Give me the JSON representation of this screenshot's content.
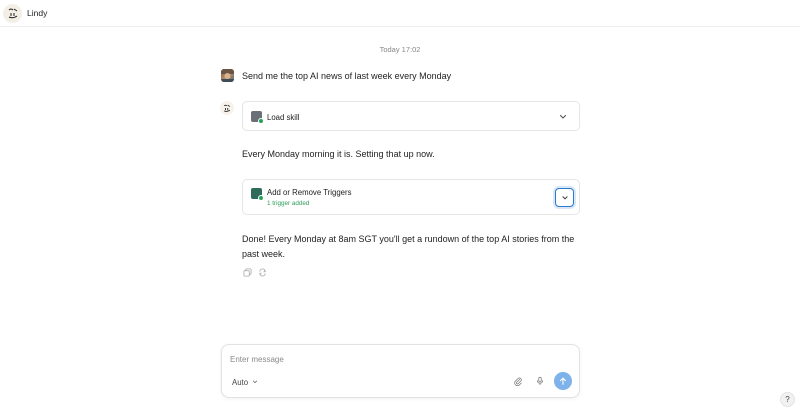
{
  "app": {
    "title": "Lindy"
  },
  "chat": {
    "timestamp": "Today 17:02",
    "user_message": "Send me the top AI news of last week every Monday",
    "tool_load_skill": {
      "title": "Load skill"
    },
    "agent_message_1": "Every Monday morning it is. Setting that up now.",
    "tool_triggers": {
      "title": "Add or Remove Triggers",
      "status": "1 trigger added"
    },
    "agent_message_2": "Done! Every Monday at 8am SGT you'll get a rundown of the top AI stories from the past week."
  },
  "composer": {
    "placeholder": "Enter message",
    "model": "Auto"
  },
  "help": {
    "label": "?"
  },
  "colors": {
    "accent": "#2a7bd0",
    "send_button": "#7db3ea",
    "success": "#2e9e5b"
  },
  "icons": {
    "logo": "lindy-logo-icon",
    "tool": "tool-icon",
    "chevron": "chevron-down-icon",
    "copy": "copy-icon",
    "regenerate": "refresh-icon",
    "attach": "paperclip-icon",
    "mic": "microphone-icon",
    "send": "arrow-up-icon"
  }
}
